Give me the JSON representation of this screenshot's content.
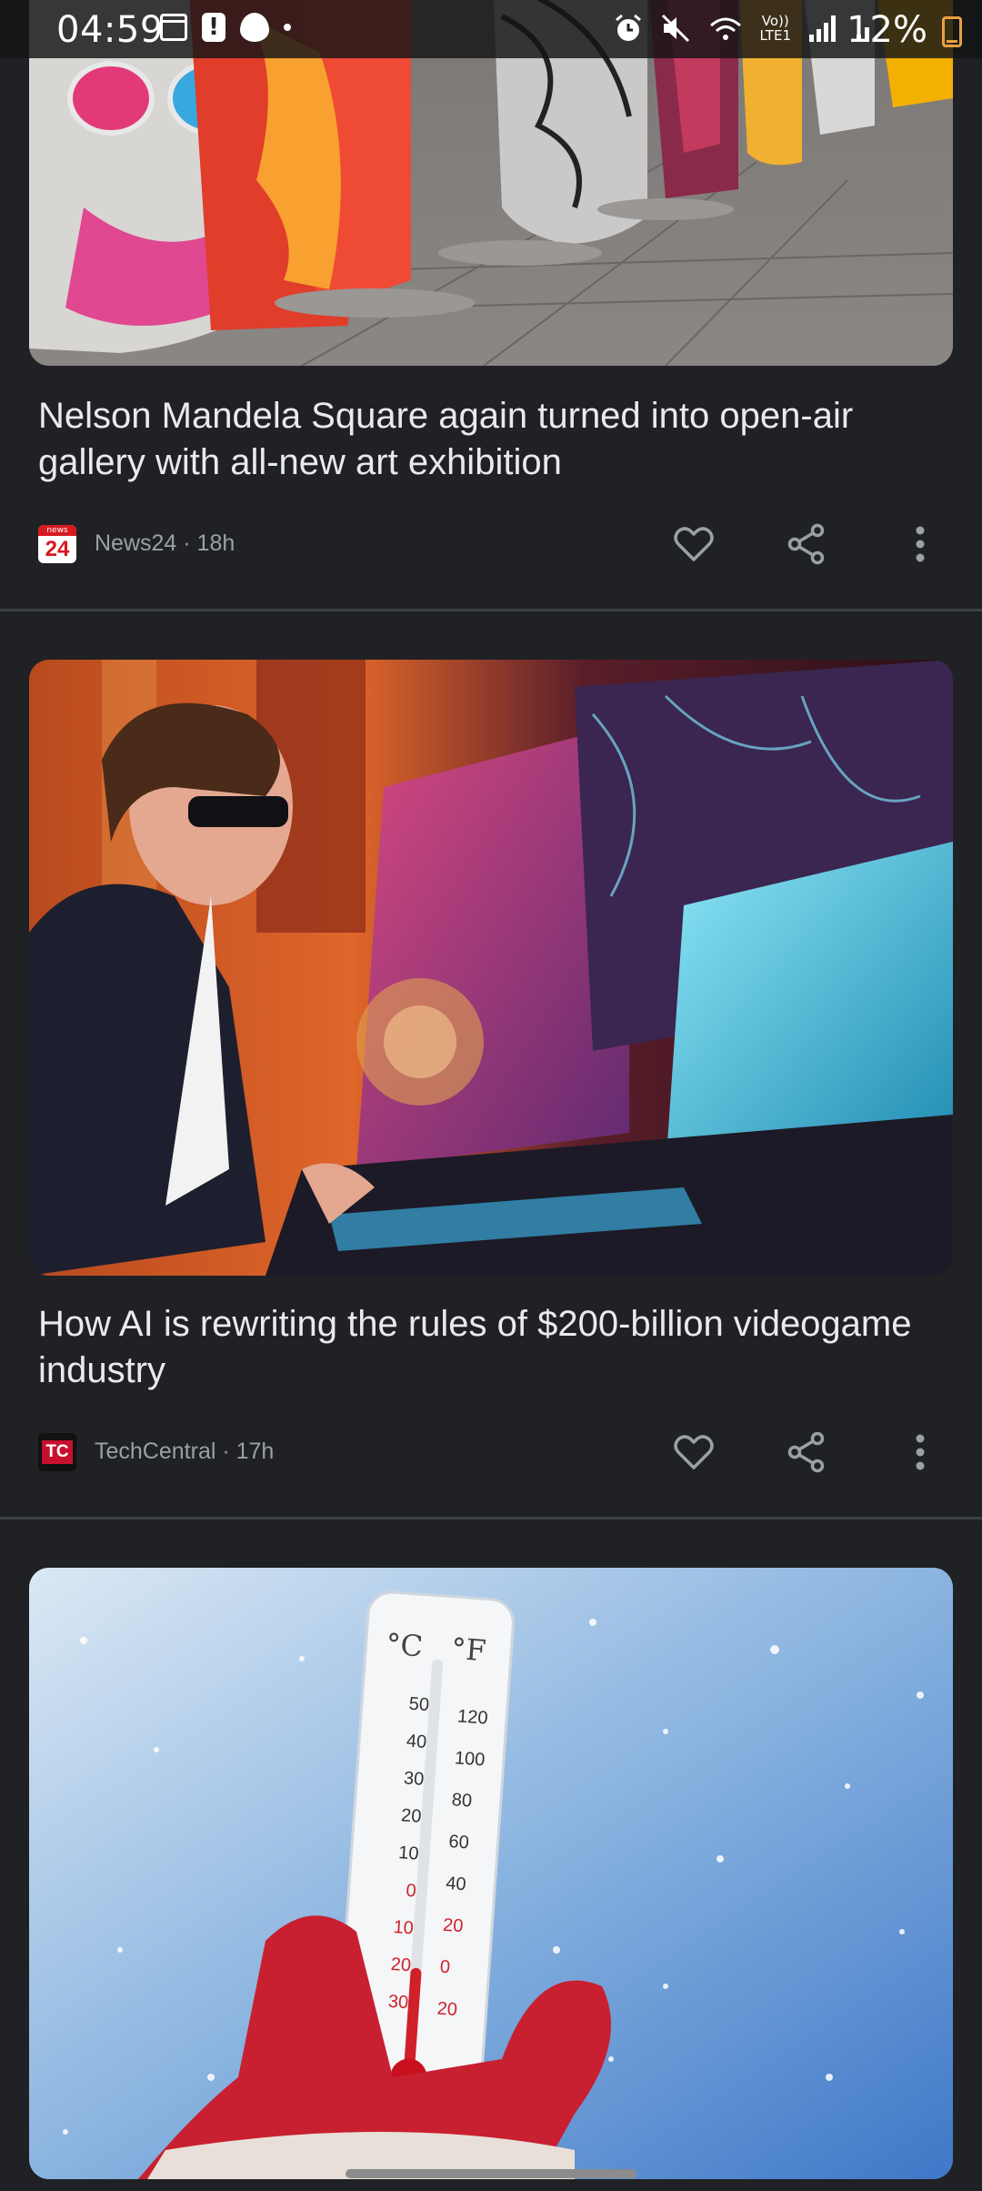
{
  "status_bar": {
    "time": "04:59",
    "left_icons": [
      "calendar-icon",
      "alert-icon",
      "flame-icon",
      "dot-icon"
    ],
    "right_icons": [
      "alarm-icon",
      "mute-icon",
      "wifi-icon",
      "volte-icon",
      "signal-icon",
      "signal-2-icon"
    ],
    "volte_label": "Vo))\nLTE1",
    "battery": "12%",
    "battery_color": "#e8a040"
  },
  "feed": [
    {
      "title": "Nelson Mandela Square again turned into open-air gallery with all-new art exhibition",
      "source": "News24 · 18h",
      "logo_top": "news",
      "logo_bottom": "24",
      "image": "colorful-sculptures-photo"
    },
    {
      "title": "How AI is rewriting the rules of $200-billion videogame industry",
      "source": "TechCentral · 17h",
      "logo_text": "TC",
      "image": "ai-gamer-photo"
    },
    {
      "image": "thermometer-snow-photo",
      "thermometer": {
        "c_label": "°C",
        "f_label": "°F",
        "c_ticks": [
          "50",
          "40",
          "30",
          "20",
          "10",
          "0",
          "10",
          "20",
          "30"
        ],
        "f_ticks": [
          "120",
          "100",
          "80",
          "60",
          "40",
          "20",
          "0",
          "20"
        ]
      }
    }
  ],
  "actions": [
    "heart-icon",
    "share-icon",
    "more-vert-icon"
  ],
  "colors": {
    "background": "#202124",
    "title_text": "#e8eaed",
    "meta_text": "#9aa0a6"
  }
}
